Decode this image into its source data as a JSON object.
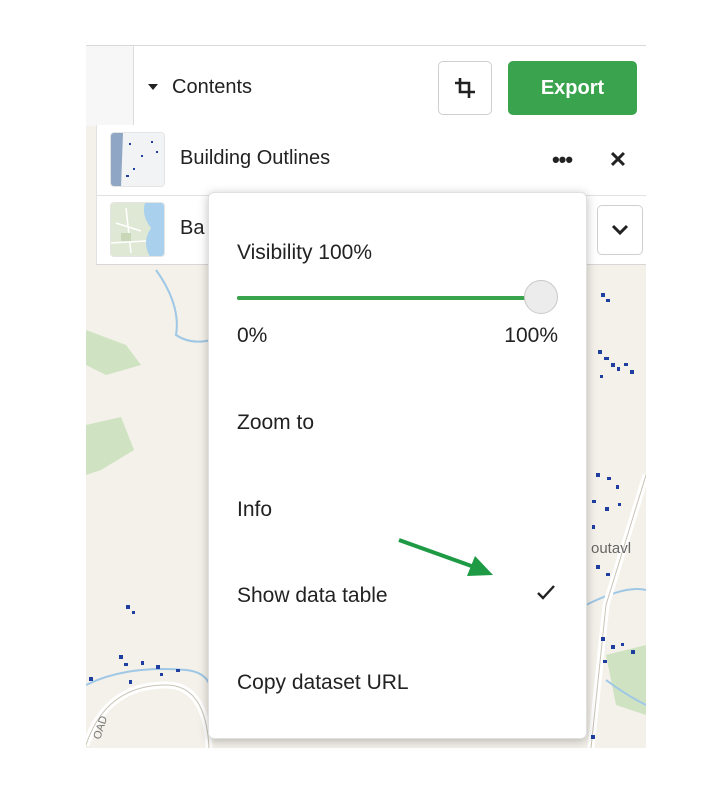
{
  "toolbar": {
    "contents_label": "Contents",
    "export_label": "Export",
    "crop_icon": "crop-icon"
  },
  "layers": [
    {
      "name": "Building Outlines",
      "thumbnail": "building-outlines-thumbnail"
    },
    {
      "name": "Ba",
      "thumbnail": "basemap-thumbnail"
    }
  ],
  "map": {
    "road_label": "OAD",
    "place_label": "outavl"
  },
  "menu": {
    "visibility_label": "Visibility 100%",
    "visibility_value": 100,
    "slider_min": "0%",
    "slider_max": "100%",
    "items": [
      {
        "label": "Zoom to",
        "checked": false
      },
      {
        "label": "Info",
        "checked": false
      },
      {
        "label": "Show data table",
        "checked": true
      },
      {
        "label": "Copy dataset URL",
        "checked": false
      }
    ]
  },
  "colors": {
    "accent": "#3aa34d",
    "annotation_arrow": "#1e9a45",
    "building_dots": "#1f3fa0"
  }
}
